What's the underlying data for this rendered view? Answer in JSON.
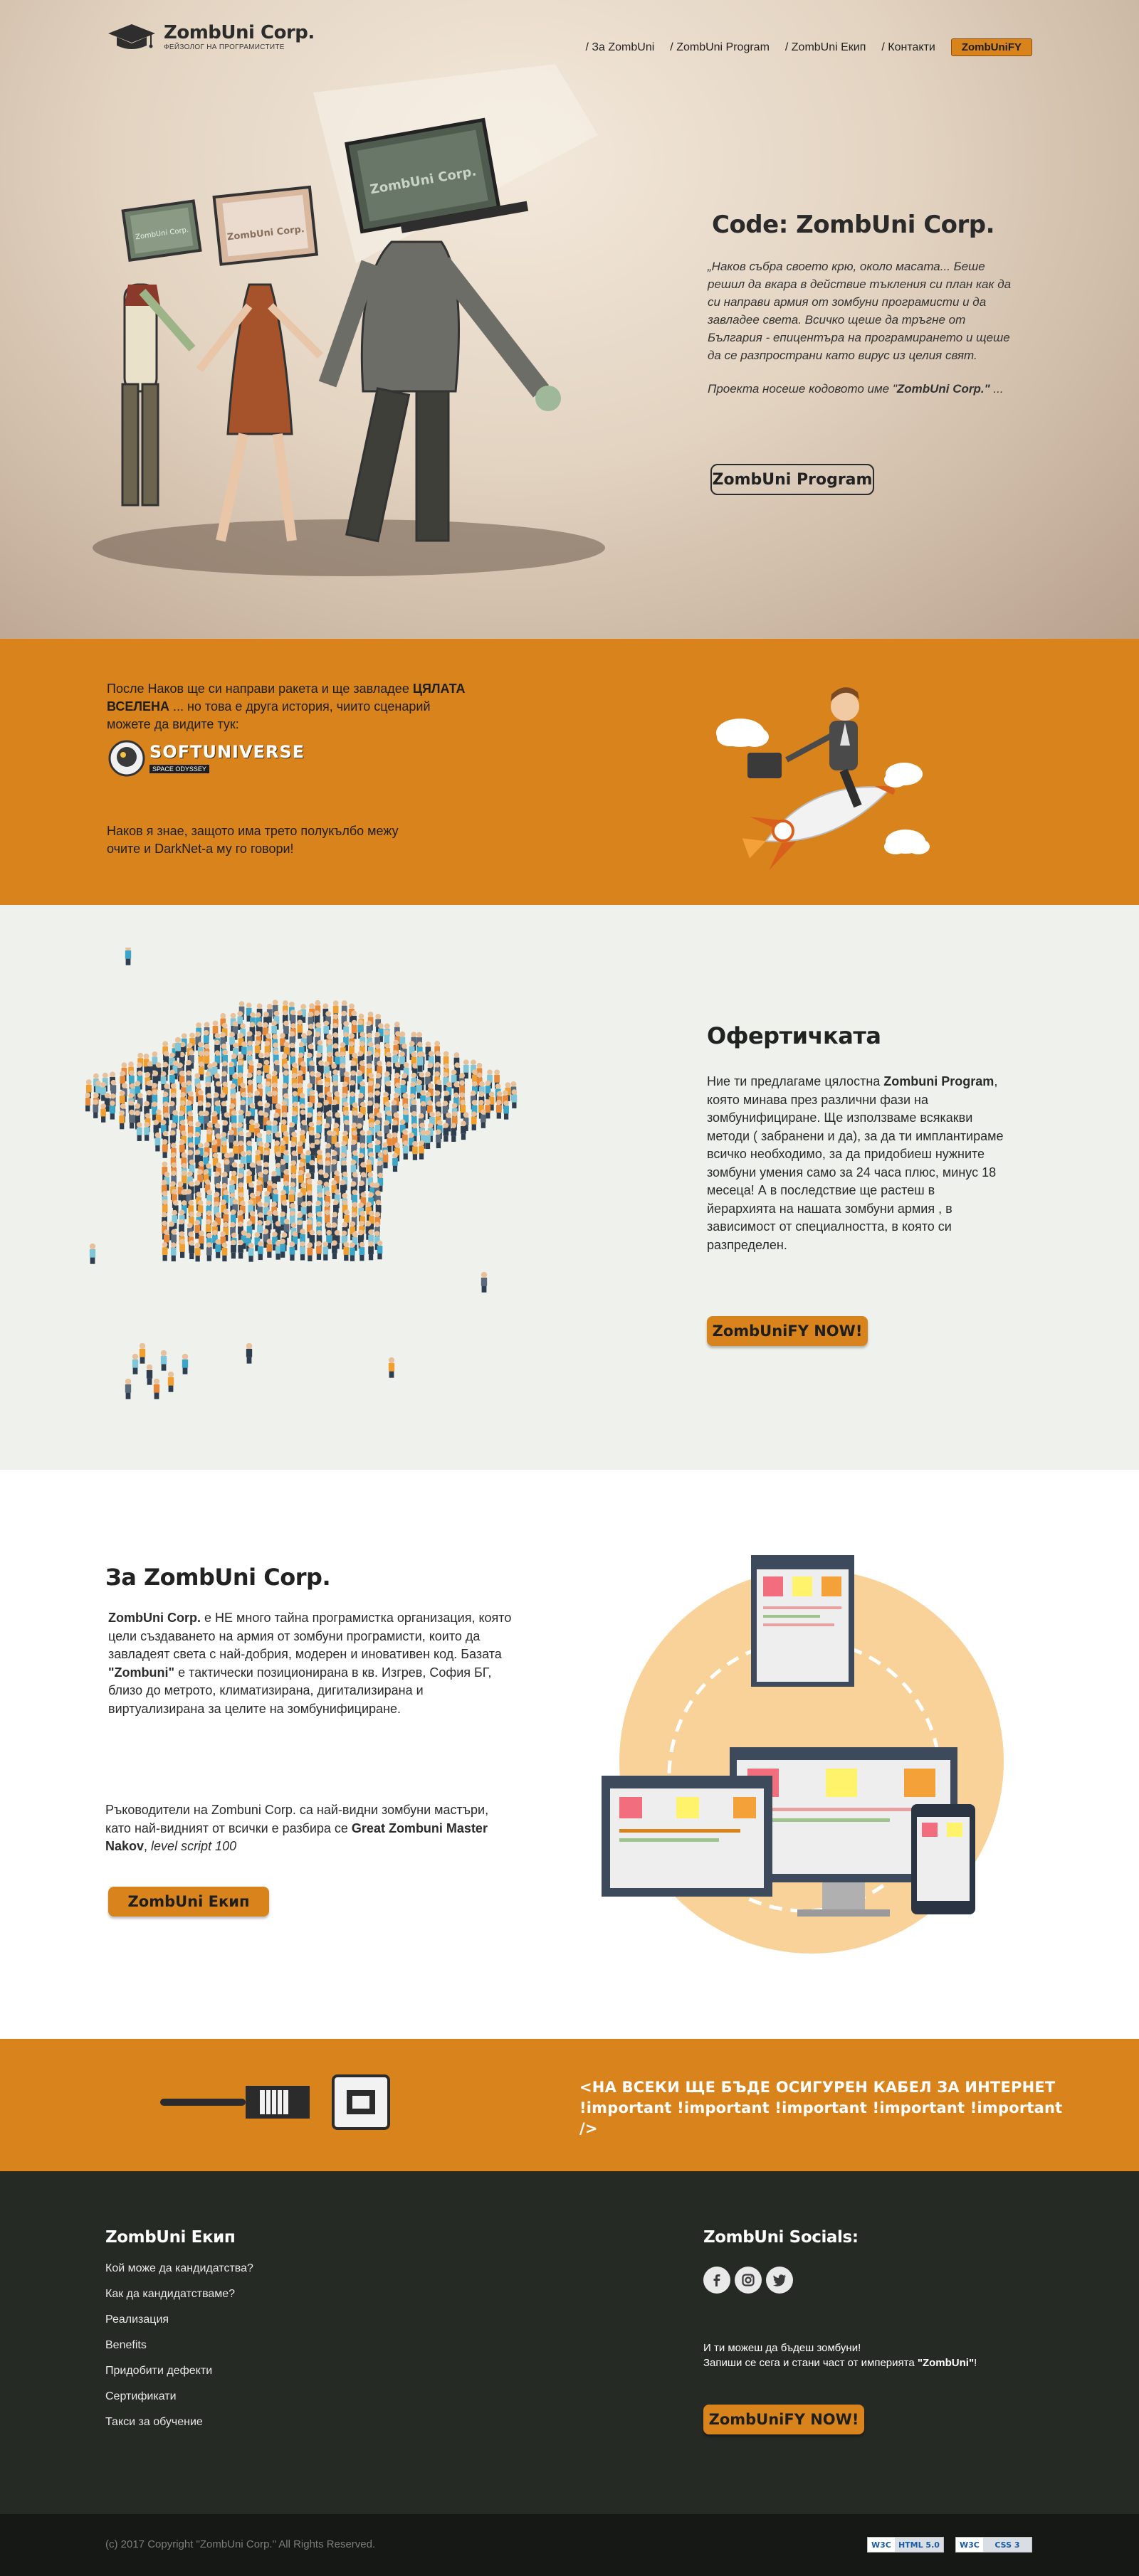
{
  "brand": {
    "name": "ZombUni Corp.",
    "tagline": "ФЕЙЗОЛОГ НА ПРОГРАМИСТИТЕ",
    "accent": "#d8831c",
    "dark": "#262a25"
  },
  "nav": {
    "items": [
      "/ За ZombUni",
      "/ ZombUni Program",
      "/ ZombUni Екип",
      "/ Контакти"
    ],
    "cta": "ZombUniFY"
  },
  "hero": {
    "title": "Code: ZombUni Corp.",
    "p1": "„Наков събра своето крю, около масата... Беше решил да вкара в действие тъкления си план как да си направи армия от зомбуни програмисти и да завладее света. Всичко щеше да тръгне от България - епицентъра на програмирането и щеше да се разпространи като вирус из целия свят.",
    "p2_prefix": "Проекта носеше кодовото име \"",
    "p2_bold": "ZombUni Corp.\"",
    "p2_suffix": " ...",
    "button": "ZombUni Program",
    "screen_labels": [
      "ZombUni Corp.",
      "ZombUni Corp.",
      "ZombUni Corp."
    ]
  },
  "orange": {
    "p1_prefix": "После Наков ще си направи ракета и ще завладее ",
    "p1_bold": "ЦЯЛАТА ВСЕЛЕНА",
    "p1_suffix": " ... но това е друга история, чиито сценарий можете да видите тук:",
    "su_name": "SOFTUNIVERSE",
    "su_sub": "SPACE ODYSSEY",
    "p2": "Наков я знае, защото има трето полукълбо межу очите и DarkNet-а му го говори!"
  },
  "offer": {
    "title": "Офертичката",
    "text_prefix": "Ние ти предлагаме цялостна ",
    "text_bold": "Zombuni Program",
    "text_suffix": ", която минава през различни фази на зомбунифициране. Ще използваме всякакви методи ( забранени и да), за да ти имплантираме всичко необходимо, за да придобиеш нужните зомбуни умения само за 24 часа плюс, минус 18 месеца! А в последствие ще растеш в йерархията на нашата зомбуни армия , в зависимост от специалността, в която си разпределен.",
    "button": "ZombUniFY NOW!"
  },
  "about": {
    "title": "За ZombUni Corp.",
    "p1_bold1": "ZombUni Corp.",
    "p1_mid": " е НЕ много тайна програмистка организация, която цели създаването на армия от зомбуни програмисти, които да завладеят света с най-добрия, модерен и иновативен код. Базата ",
    "p1_bold2": "\"Zombuni\"",
    "p1_suffix": " е тактически позиционирана в кв. Изгрев, София БГ, близо до метрото, климатизирана, дигитализирана и виртуализирана за целите на зомбунифициране.",
    "p2_prefix": "Ръководители на Zombuni Corp. са най-видни зомбуни мастъри, като най-видният от всички е разбира се ",
    "p2_bold": "Great Zombuni Master Nakov",
    "p2_sep": ", ",
    "p2_italic": "level script 100",
    "button": "ZombUni Екип"
  },
  "cable": {
    "line1": "<НА ВСЕКИ ЩЕ БЪДЕ ОСИГУРЕН КАБЕЛ ЗА ИНТЕРНЕТ",
    "line2": "!important !important !important !important !important />"
  },
  "footer": {
    "team_title": "ZombUni Екип",
    "links": [
      "Кой може да кандидатства?",
      "Как да кандидатстваме?",
      "Реализация",
      "Benefits",
      "Придобити дефекти",
      "Сертификати",
      "Такси за обучение"
    ],
    "socials_title": "ZombUni Socials:",
    "social_icons": [
      "facebook-icon",
      "instagram-icon",
      "twitter-icon"
    ],
    "tag_line1": "И ти можеш да бъдеш зомбуни!",
    "tag_line2_prefix": "Запиши се сега и стани част  от империята ",
    "tag_line2_bold": "\"ZombUni\"",
    "tag_line2_suffix": "!",
    "button": "ZombUniFY NOW!",
    "copyright": "(c) 2017 Copyright \"ZombUni Corp.\" All Rights Reserved.",
    "badges": [
      {
        "w": "W3C",
        "t": "HTML 5.0"
      },
      {
        "w": "W3C",
        "t": "CSS 3"
      }
    ]
  }
}
